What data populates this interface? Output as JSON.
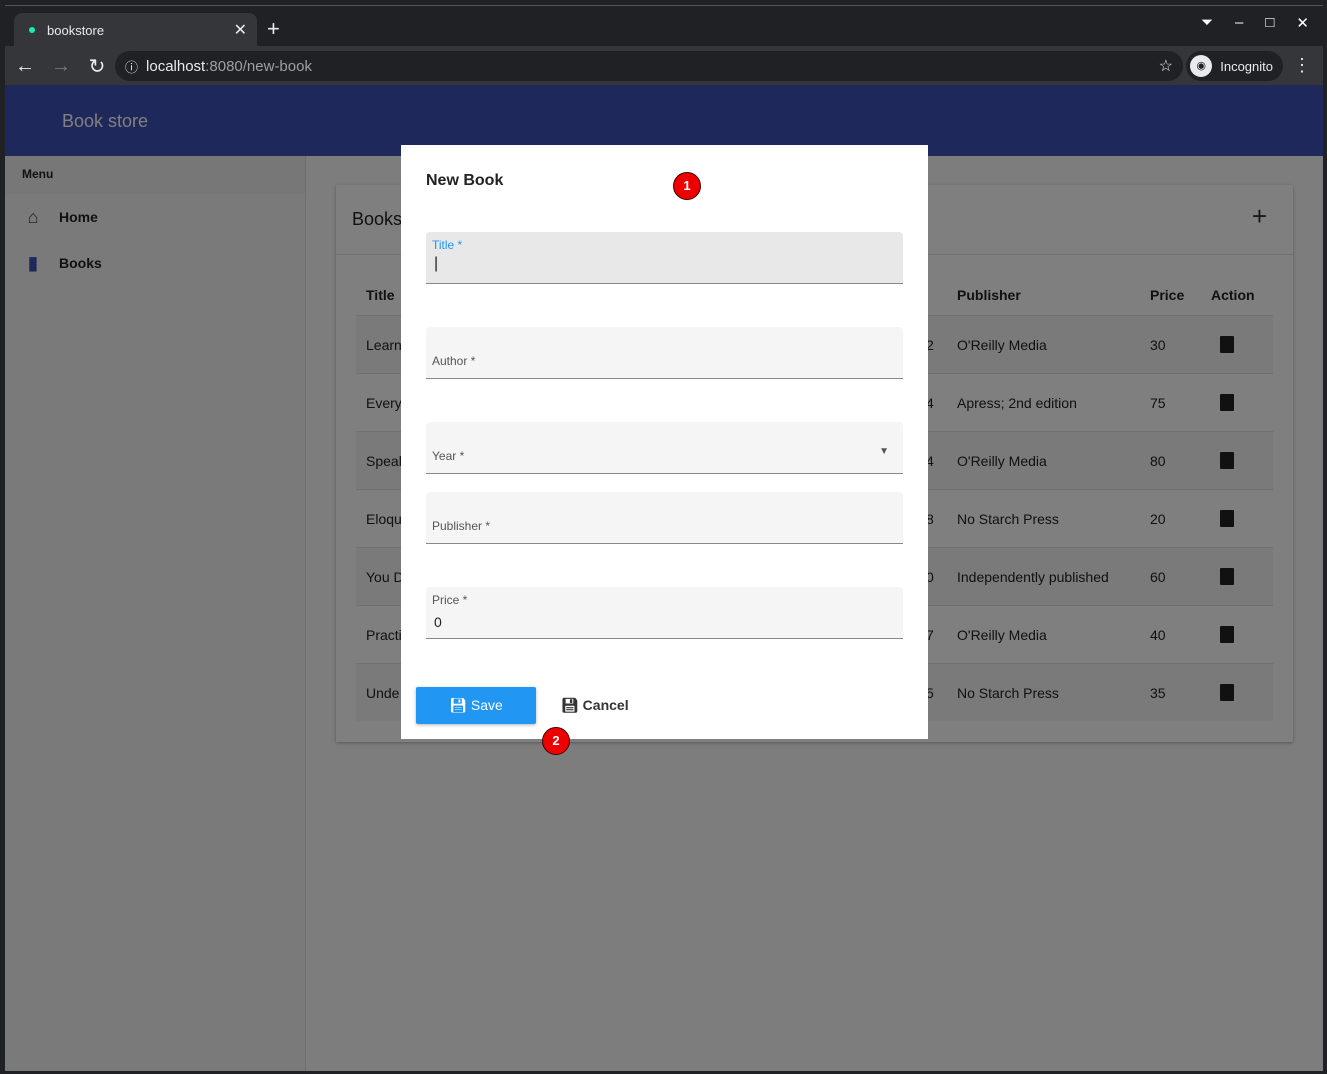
{
  "browser": {
    "tab_title": "bookstore",
    "url_host": "localhost",
    "url_rest": ":8080/new-book",
    "incognito_label": "Incognito"
  },
  "app": {
    "title": "Book store"
  },
  "sidebar": {
    "menu_label": "Menu",
    "items": [
      {
        "label": "Home",
        "icon": "home-icon"
      },
      {
        "label": "Books",
        "icon": "book-icon"
      }
    ]
  },
  "books": {
    "title": "Books",
    "columns": {
      "title": "Title",
      "publisher": "Publisher",
      "price": "Price",
      "action": "Action"
    },
    "rows": [
      {
        "title": "Learn",
        "year": "2",
        "publisher": "O'Reilly Media",
        "price": "30"
      },
      {
        "title": "Every",
        "year": "4",
        "publisher": "Apress; 2nd edition",
        "price": "75"
      },
      {
        "title": "Speal",
        "year": "4",
        "publisher": "O'Reilly Media",
        "price": "80"
      },
      {
        "title": "Eloqu",
        "year": "8",
        "publisher": "No Starch Press",
        "price": "20"
      },
      {
        "title": "You D",
        "year": "0",
        "publisher": "Independently published",
        "price": "60"
      },
      {
        "title": "Practi",
        "year": "7",
        "publisher": "O'Reilly Media",
        "price": "40"
      },
      {
        "title": "Unde",
        "year": "5",
        "publisher": "No Starch Press",
        "price": "35"
      }
    ]
  },
  "dialog": {
    "title": "New Book",
    "fields": {
      "title": "Title *",
      "author": "Author *",
      "year": "Year *",
      "publisher": "Publisher *",
      "price": "Price *",
      "price_value": "0"
    },
    "save": "Save",
    "cancel": "Cancel"
  },
  "annotations": [
    "1",
    "2"
  ],
  "colors": {
    "primary": "#3f51b5",
    "save": "#2196f3",
    "badge": "#ee0000"
  }
}
